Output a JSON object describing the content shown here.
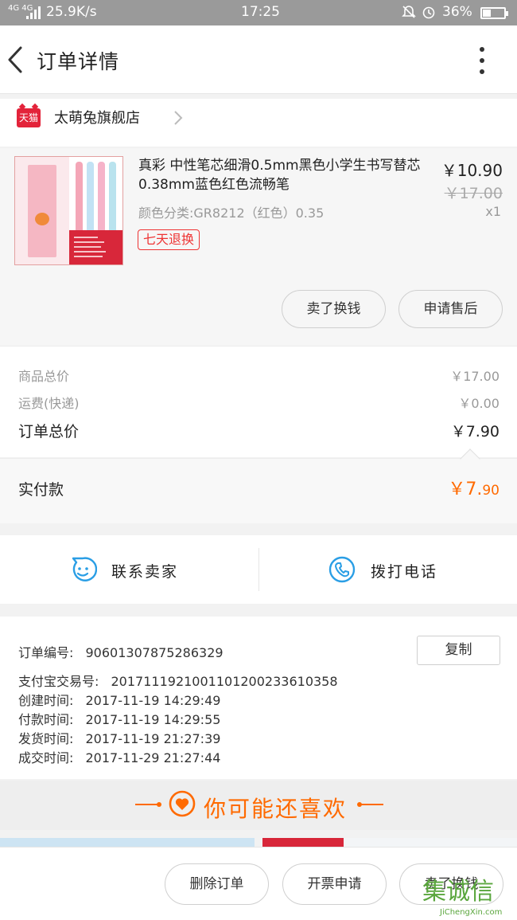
{
  "status_bar": {
    "network": "4G 4G",
    "speed": "25.9K/s",
    "time": "17:25",
    "battery": "36%"
  },
  "header": {
    "title": "订单详情"
  },
  "store": {
    "badge": "天猫",
    "name": "太萌兔旗舰店"
  },
  "product": {
    "title": "真彩 中性笔芯细滑0.5mm黑色小学生书写替芯0.38mm蓝色红色流畅笔",
    "spec": "颜色分类:GR8212（红色）0.35",
    "tag": "七天退换",
    "price": "￥10.90",
    "original_price": "￥17.00",
    "quantity": "x1",
    "buttons": {
      "sell": "卖了换钱",
      "after_sale": "申请售后"
    }
  },
  "summary": {
    "goods_total_label": "商品总价",
    "goods_total_value": "￥17.00",
    "shipping_label": "运费(快递)",
    "shipping_value": "￥0.00",
    "order_total_label": "订单总价",
    "order_total_value": "￥7.90",
    "paid_label": "实付款",
    "paid_currency": "￥",
    "paid_int": "7.",
    "paid_dec": "90"
  },
  "contact": {
    "seller": "联系卖家",
    "call": "拨打电话"
  },
  "order_info": {
    "order_no_label": "订单编号:",
    "order_no": "90601307875286329",
    "copy_label": "复制",
    "alipay_label": "支付宝交易号:",
    "alipay_no": "2017111921001101200233610358",
    "created_label": "创建时间:",
    "created": "2017-11-19 14:29:49",
    "paid_label": "付款时间:",
    "paid": "2017-11-19 14:29:55",
    "shipped_label": "发货时间:",
    "shipped": "2017-11-19 21:27:39",
    "done_label": "成交时间:",
    "done": "2017-11-29 21:27:44"
  },
  "recommend": {
    "title": "你可能还喜欢"
  },
  "bottom_bar": {
    "delete": "删除订单",
    "invoice": "开票申请",
    "sell": "卖了换钱"
  },
  "watermark": {
    "cn": "集诚信",
    "en": "JiChengXin.com"
  },
  "colors": {
    "accent": "#ff6a00",
    "tmall_red": "#e3233a",
    "contact_blue": "#2a9ee5"
  }
}
